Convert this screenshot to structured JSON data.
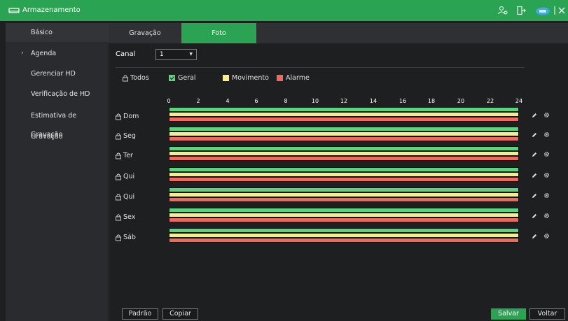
{
  "window": {
    "title": "Armazenamento"
  },
  "sidebar": {
    "items": [
      {
        "label": "Básico"
      },
      {
        "label": "Agenda",
        "chevron": "›"
      },
      {
        "label": "Gerenciar HD"
      },
      {
        "label": "Verificação de HD"
      },
      {
        "label": "Estimativa de Gravação"
      },
      {
        "label": "Gravação"
      }
    ]
  },
  "tabs": [
    {
      "label": "Gravação"
    },
    {
      "label": "Foto"
    }
  ],
  "channel": {
    "label": "Canal",
    "value": "1"
  },
  "legend": {
    "all_label": "Todos",
    "items": [
      {
        "label": "Geral",
        "color": "#5cd37f"
      },
      {
        "label": "Movimento",
        "color": "#f3ee8e"
      },
      {
        "label": "Alarme",
        "color": "#ee6a5c"
      }
    ]
  },
  "timeline": {
    "hours": [
      "0",
      "2",
      "4",
      "6",
      "8",
      "10",
      "12",
      "14",
      "16",
      "18",
      "20",
      "22",
      "24"
    ]
  },
  "days": [
    {
      "label": "Dom"
    },
    {
      "label": "Seg"
    },
    {
      "label": "Ter"
    },
    {
      "label": "Qui"
    },
    {
      "label": "Qui"
    },
    {
      "label": "Sex"
    },
    {
      "label": "Sáb"
    }
  ],
  "buttons": {
    "default": "Padrão",
    "copy": "Copiar",
    "save": "Salvar",
    "back": "Voltar"
  },
  "colors": {
    "accent": "#2aa452",
    "geral": "#5cd37f",
    "movimento": "#f3ee8e",
    "alarme": "#ee6a5c"
  }
}
